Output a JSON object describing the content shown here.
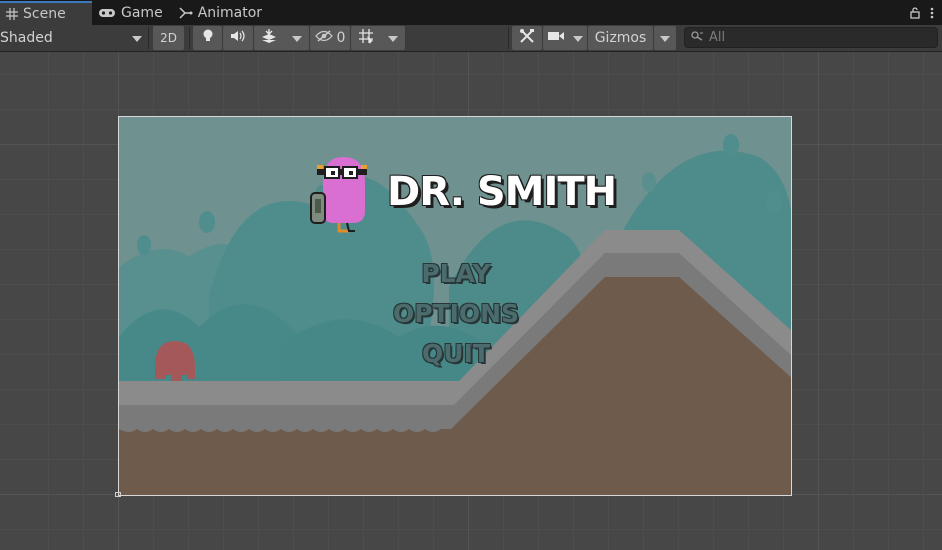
{
  "tabs": [
    {
      "label": "Scene",
      "icon": "grid-icon",
      "active": true
    },
    {
      "label": "Game",
      "icon": "gamepad-icon",
      "active": false
    },
    {
      "label": "Animator",
      "icon": "animator-icon",
      "active": false
    }
  ],
  "toolbar": {
    "shading_mode": "Shaded",
    "toggle_2d": "2D",
    "hidden_count": "0",
    "gizmos": "Gizmos"
  },
  "search": {
    "placeholder": "All"
  },
  "game": {
    "title": "DR. SMITH",
    "menu": [
      "PLAY",
      "OPTIONS",
      "QUIT"
    ]
  },
  "colors": {
    "accent": "#3a79bb",
    "sky": "#6f9190",
    "hills": "#4a8c8b",
    "ground": "#6e5a4a",
    "path": "#8a8a8a"
  }
}
